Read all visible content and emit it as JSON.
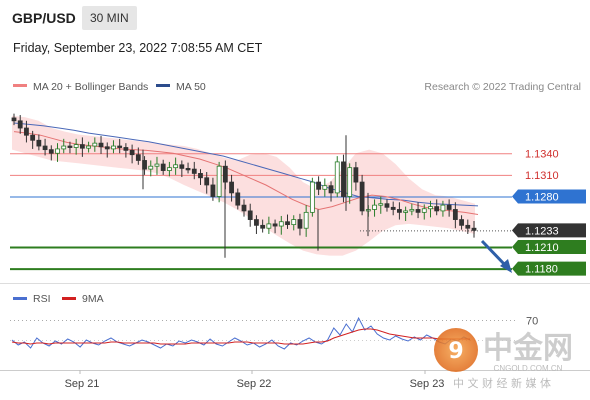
{
  "header": {
    "pair": "GBP/USD",
    "timeframe": "30 MIN",
    "datetime": "Friday, September 23, 2022 7:08:55 AM CET"
  },
  "legend": {
    "items": [
      {
        "label": "MA 20 + Bollinger Bands",
        "color": "#f08080"
      },
      {
        "label": "MA 50",
        "color": "#2c4c8c"
      }
    ],
    "credit": "Research © 2022 Trading Central"
  },
  "watermark": {
    "brand": "中金网",
    "site": "CNGOLD.COM.CN",
    "tagline": "中 文 财 经 新 媒 体"
  },
  "chart_data": [
    {
      "type": "candlestick",
      "instrument": "GBP/USD",
      "timeframe": "30 MIN",
      "x_tick_labels": [
        "Sep 21",
        "Sep 22",
        "Sep 23"
      ],
      "y_axis": {
        "range": [
          1.116,
          1.14
        ],
        "tick_labels": []
      },
      "levels": [
        {
          "label": "1.1340",
          "value": 1.134,
          "style": "line",
          "color": "#f08080"
        },
        {
          "label": "1.1310",
          "value": 1.131,
          "style": "line",
          "color": "#f08080"
        },
        {
          "label": "1.1280",
          "value": 1.128,
          "style": "box",
          "color": "#2f73d1"
        },
        {
          "label": "1.1233",
          "value": 1.1233,
          "style": "box",
          "color": "#333333"
        },
        {
          "label": "1.1210",
          "value": 1.121,
          "style": "box",
          "color": "#2e7d1f"
        },
        {
          "label": "1.1180",
          "value": 1.118,
          "style": "box",
          "color": "#2e7d1f"
        }
      ],
      "close_path": [
        1.1385,
        1.1375,
        1.1365,
        1.1358,
        1.135,
        1.1345,
        1.134,
        1.1346,
        1.135,
        1.1348,
        1.1352,
        1.1347,
        1.135,
        1.1354,
        1.1349,
        1.1346,
        1.135,
        1.1348,
        1.1344,
        1.1338,
        1.133,
        1.1318,
        1.1322,
        1.1325,
        1.1316,
        1.132,
        1.1324,
        1.1319,
        1.1318,
        1.1312,
        1.1306,
        1.1296,
        1.128,
        1.1322,
        1.13,
        1.1285,
        1.1268,
        1.126,
        1.1248,
        1.124,
        1.1236,
        1.1242,
        1.1239,
        1.1245,
        1.1241,
        1.1248,
        1.1236,
        1.1258,
        1.13,
        1.129,
        1.1295,
        1.1285,
        1.1328,
        1.128,
        1.132,
        1.13,
        1.126,
        1.1262,
        1.1268,
        1.127,
        1.1265,
        1.1262,
        1.1258,
        1.126,
        1.1262,
        1.1258,
        1.1263,
        1.1266,
        1.126,
        1.1268,
        1.1262,
        1.1248,
        1.124,
        1.1236,
        1.1233
      ],
      "ma50": [
        1.1382,
        1.138,
        1.1378,
        1.1375,
        1.1372,
        1.1368,
        1.1365,
        1.1362,
        1.1359,
        1.1356,
        1.1352,
        1.1348,
        1.1344,
        1.134,
        1.1336,
        1.133,
        1.1324,
        1.1318,
        1.1312,
        1.1306,
        1.13,
        1.1292,
        1.1286,
        1.128,
        1.1278,
        1.1276,
        1.1275,
        1.1272,
        1.127,
        1.1269,
        1.1268,
        1.1267
      ],
      "ma20": [
        1.137,
        1.1368,
        1.1365,
        1.136,
        1.1355,
        1.1352,
        1.135,
        1.1348,
        1.1346,
        1.1345,
        1.1344,
        1.1342,
        1.134,
        1.1336,
        1.1332,
        1.1326,
        1.132,
        1.1312,
        1.1304,
        1.1296,
        1.1286,
        1.1276,
        1.1268,
        1.1262,
        1.1266,
        1.1272,
        1.1278,
        1.1282,
        1.128,
        1.1276,
        1.127,
        1.1265,
        1.1262,
        1.126,
        1.1258,
        1.1255
      ],
      "bollinger_upper": [
        1.1392,
        1.139,
        1.1385,
        1.1375,
        1.137,
        1.1366,
        1.1364,
        1.1362,
        1.136,
        1.1358,
        1.1356,
        1.1354,
        1.1352,
        1.135,
        1.1346,
        1.134,
        1.1334,
        1.133,
        1.1338,
        1.134,
        1.1335,
        1.132,
        1.13,
        1.129,
        1.13,
        1.1318,
        1.134,
        1.1345,
        1.134,
        1.1325,
        1.1305,
        1.129,
        1.1282,
        1.128,
        1.1275,
        1.127
      ],
      "bollinger_lower": [
        1.1345,
        1.134,
        1.1335,
        1.133,
        1.1328,
        1.1326,
        1.1324,
        1.1322,
        1.132,
        1.1318,
        1.1316,
        1.1312,
        1.1305,
        1.1296,
        1.1288,
        1.128,
        1.1272,
        1.1262,
        1.125,
        1.1238,
        1.1226,
        1.1215,
        1.1205,
        1.12,
        1.1198,
        1.1198,
        1.1205,
        1.1218,
        1.1232,
        1.124,
        1.1242,
        1.124,
        1.1238,
        1.1236,
        1.1232,
        1.1228
      ]
    },
    {
      "type": "line",
      "title": "RSI",
      "series": [
        {
          "name": "RSI",
          "color": "#4a6fd0"
        },
        {
          "name": "9MA",
          "color": "#d22020"
        }
      ],
      "levels": [
        {
          "label": "70",
          "value": 70
        }
      ],
      "ylim": [
        20,
        80
      ],
      "rsi": [
        50,
        45,
        48,
        42,
        52,
        47,
        44,
        49,
        46,
        51,
        48,
        43,
        50,
        47,
        45,
        49,
        52,
        48,
        46,
        44,
        47,
        50,
        48,
        45,
        42,
        46,
        44,
        49,
        47,
        50,
        48,
        45,
        51,
        46,
        44,
        48,
        52,
        49,
        45,
        47,
        43,
        46,
        50,
        44,
        41,
        47,
        45,
        49,
        52,
        48,
        46,
        50,
        62,
        55,
        66,
        58,
        72,
        60,
        64,
        56,
        52,
        50,
        54,
        51,
        49,
        53,
        50,
        55,
        52,
        48,
        46,
        51,
        49,
        53,
        50
      ],
      "ma9": [
        48,
        47,
        47,
        46,
        47,
        47,
        46,
        47,
        47,
        47,
        47,
        47,
        47,
        47,
        47,
        47,
        48,
        48,
        47,
        47,
        47,
        47,
        47,
        47,
        46,
        46,
        46,
        46,
        46,
        47,
        47,
        47,
        47,
        47,
        47,
        47,
        48,
        48,
        48,
        47,
        47,
        47,
        47,
        47,
        46,
        46,
        46,
        46,
        47,
        48,
        48,
        49,
        52,
        54,
        56,
        58,
        60,
        61,
        61,
        60,
        58,
        56,
        55,
        54,
        53,
        52,
        52,
        52,
        52,
        51,
        51,
        51,
        51,
        51,
        51
      ]
    }
  ]
}
